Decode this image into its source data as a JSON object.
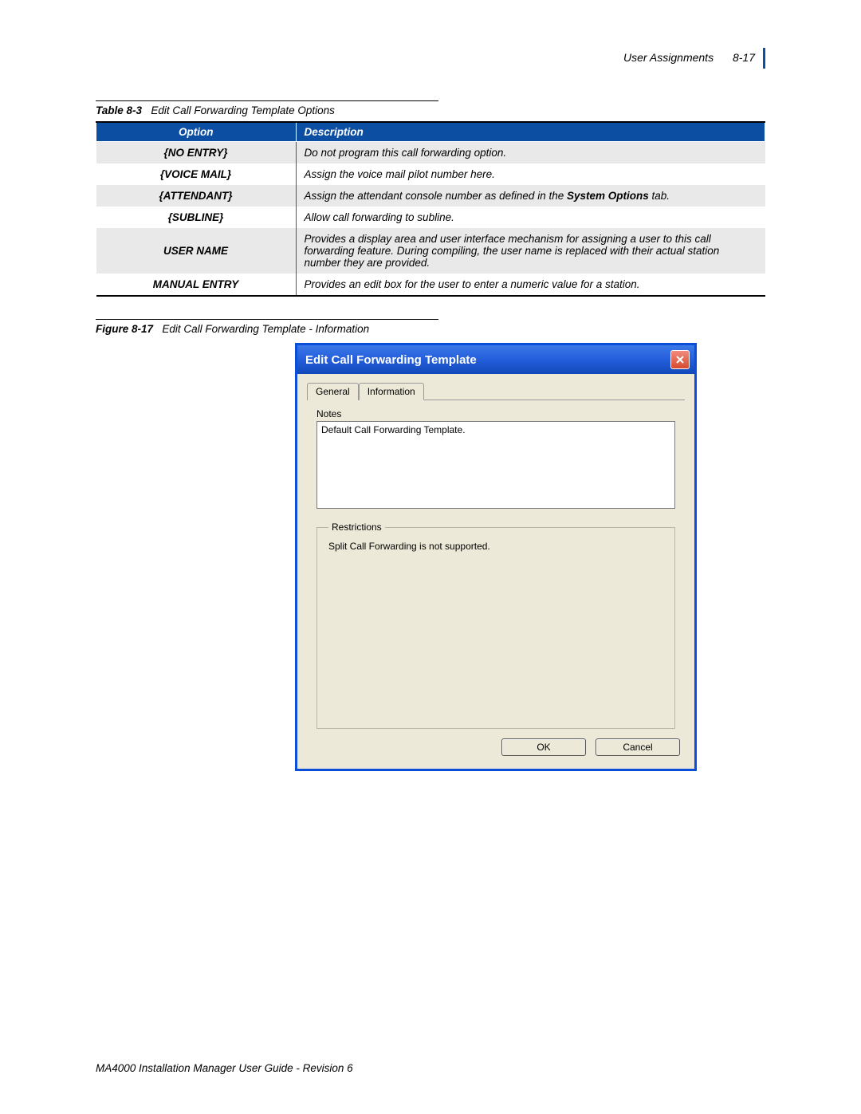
{
  "header": {
    "section": "User Assignments",
    "page": "8-17"
  },
  "table_caption": {
    "label": "Table 8-3",
    "text": "Edit Call Forwarding Template Options"
  },
  "table": {
    "col_option": "Option",
    "col_desc": "Description",
    "rows": [
      {
        "opt": "{NO ENTRY}",
        "desc_plain": "Do not program this call forwarding option."
      },
      {
        "opt": "{VOICE MAIL}",
        "desc_plain": "Assign the voice mail pilot number here."
      },
      {
        "opt": "{ATTENDANT}",
        "desc_pre": "Assign the attendant console number as defined in the ",
        "desc_bold": "System Options",
        "desc_post": " tab."
      },
      {
        "opt": "{SUBLINE}",
        "desc_plain": "Allow call forwarding to subline."
      },
      {
        "opt": "USER NAME",
        "desc_plain": "Provides a display area and user interface mechanism for assigning a user to this call forwarding feature. During compiling, the user name is replaced with their actual station number they are provided."
      },
      {
        "opt": "MANUAL ENTRY",
        "desc_plain": "Provides an edit box for the user to enter a numeric value for a station."
      }
    ]
  },
  "figure_caption": {
    "label": "Figure 8-17",
    "text": "Edit Call Forwarding Template - Information"
  },
  "dialog": {
    "title": "Edit Call Forwarding Template",
    "tab_general": "General",
    "tab_info": "Information",
    "notes_label": "Notes",
    "notes_value": "Default Call Forwarding Template.",
    "restrictions_legend": "Restrictions",
    "restrictions_text": "Split Call Forwarding is not supported.",
    "ok": "OK",
    "cancel": "Cancel"
  },
  "footer": "MA4000 Installation Manager User Guide - Revision 6"
}
